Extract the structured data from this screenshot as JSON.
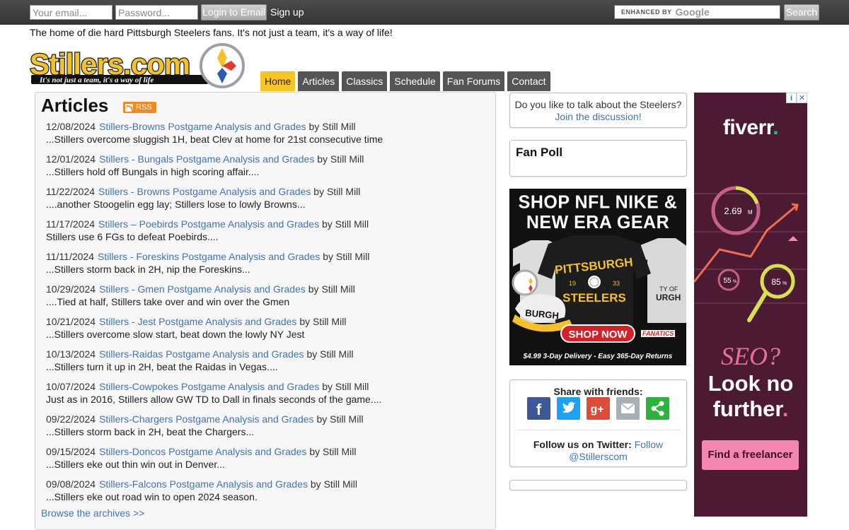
{
  "topbar": {
    "email_placeholder": "Your email...",
    "password_placeholder": "Password...",
    "login_label": "Login to Email",
    "signup_label": "Sign up",
    "search_enhanced": "ENHANCED BY",
    "search_google": "Google",
    "search_label": "Search"
  },
  "tagline": "The home of die hard Pittsburgh Steelers fans. It's not just a team, it's a way of life!",
  "logo": {
    "text": "Stillers.com",
    "slogan": "It's not just a team, it's a way of life"
  },
  "nav": [
    {
      "label": "Home",
      "active": true
    },
    {
      "label": "Articles"
    },
    {
      "label": "Classics"
    },
    {
      "label": "Schedule"
    },
    {
      "label": "Fan Forums"
    },
    {
      "label": "Contact"
    }
  ],
  "articles": {
    "heading": "Articles",
    "rss_label": "RSS",
    "archives_link": "Browse the archives >>",
    "items": [
      {
        "date": "12/08/2024",
        "title": "Stillers-Browns Postgame Analysis and Grades",
        "by": "by Still Mill",
        "summary": "...Stillers overcome sluggish 1H, beat Clev at home for 21st consecutive time"
      },
      {
        "date": "12/01/2024",
        "title": "Stillers - Bungals Postgame Analysis and Grades",
        "by": "by Still Mill",
        "summary": "...Stillers hold off Bungals in high scoring affair...."
      },
      {
        "date": "11/22/2024",
        "title": "Stillers - Browns Postgame Analysis and Grades",
        "by": "by Still Mill",
        "summary": "....another Stoogelin egg lay; Stillers lose to lowly Browns..."
      },
      {
        "date": "11/17/2024",
        "title": "Stillers – Poebirds Postgame Analysis and Grades",
        "by": "by Still Mill",
        "summary": "Stillers use 6 FGs to defeat Poebirds...."
      },
      {
        "date": "11/11/2024",
        "title": "Stillers - Foreskins Postgame Analysis and Grades",
        "by": "by Still Mill",
        "summary": "...Stillers storm back in 2H, nip the Foreskins..."
      },
      {
        "date": "10/29/2024",
        "title": "Stillers - Gmen Postgame Analysis and Grades",
        "by": "by Still Mill",
        "summary": "....Tied at half, Stillers take over and win over the Gmen"
      },
      {
        "date": "10/21/2024",
        "title": "Stillers - Jest Postgame Analysis and Grades",
        "by": "by Still Mill",
        "summary": "...Stillers overcome slow start, beat down the lowly NY Jest"
      },
      {
        "date": "10/13/2024",
        "title": "Stillers-Raidas Postgame Analysis and Grades",
        "by": "by Still Mill",
        "summary": "...Stillers turn it up in 2H, beat the Raidas in Vegas...."
      },
      {
        "date": "10/07/2024",
        "title": "Stillers-Cowpokes Postgame Analysis and Grades",
        "by": "by Still Mill",
        "summary": "Just as in 2016, Stillers allow GW TD to Dall in finals seconds of the game...."
      },
      {
        "date": "09/22/2024",
        "title": "Stillers-Chargers Postgame Analysis and Grades",
        "by": "by Still Mill",
        "summary": "...Stillers storm back in 2H, beat the Chargers..."
      },
      {
        "date": "09/15/2024",
        "title": "Stillers-Doncos Postgame Analysis and Grades",
        "by": "by Still Mill",
        "summary": "...Stillers eke out thin win out in Denver..."
      },
      {
        "date": "09/08/2024",
        "title": "Stillers-Falcons Postgame Analysis and Grades",
        "by": "by Still Mill",
        "summary": "...Stillers eke out road win to open 2024 season."
      }
    ]
  },
  "sidebar": {
    "talk_text": "Do you like to talk about the Steelers?",
    "talk_link": "Join the discussion!",
    "poll_title": "Fan Poll",
    "share_title": "Share with friends:",
    "share_icons": [
      "facebook-icon",
      "twitter-icon",
      "google-plus-icon",
      "email-icon",
      "share-icon"
    ],
    "follow_label": "Follow us on Twitter:",
    "follow_link_1": "Follow",
    "follow_link_2": "@Stillerscom"
  },
  "nfl_ad": {
    "headline_1": "SHOP NFL NIKE &",
    "headline_2": "NEW ERA GEAR",
    "shirt_text_1": "PITTSBURGH",
    "shirt_text_2": "STEELERS",
    "shirt_year_1": "19",
    "shirt_year_2": "33",
    "hat_text": "BURGH",
    "side_text_1": "TY OF",
    "side_text_2": "URGH",
    "cta": "SHOP NOW",
    "footer": "$4.99 3-Day Delivery - Easy 365-Day Returns",
    "fanatics": "FANATICS"
  },
  "fiverr_ad": {
    "brand": "fiverr",
    "brand_dot": ".",
    "metric_1": "2.69",
    "metric_1_unit": "M",
    "metric_2": "55",
    "metric_3": "85",
    "metric_unit": "%",
    "seo": "SEO?",
    "look_1": "Look no",
    "look_2": "further",
    "look_dot": ".",
    "cta": "Find a freelancer",
    "adchoice_info": "i",
    "adchoice_close": "✕"
  },
  "colors": {
    "accent_link": "#3a75b5",
    "nav_active": "#f7c325",
    "nav_default": "#555555",
    "fiverr_bg": "#4c1a33",
    "fiverr_green": "#1dbf73",
    "fiverr_pink": "#f386b3"
  }
}
